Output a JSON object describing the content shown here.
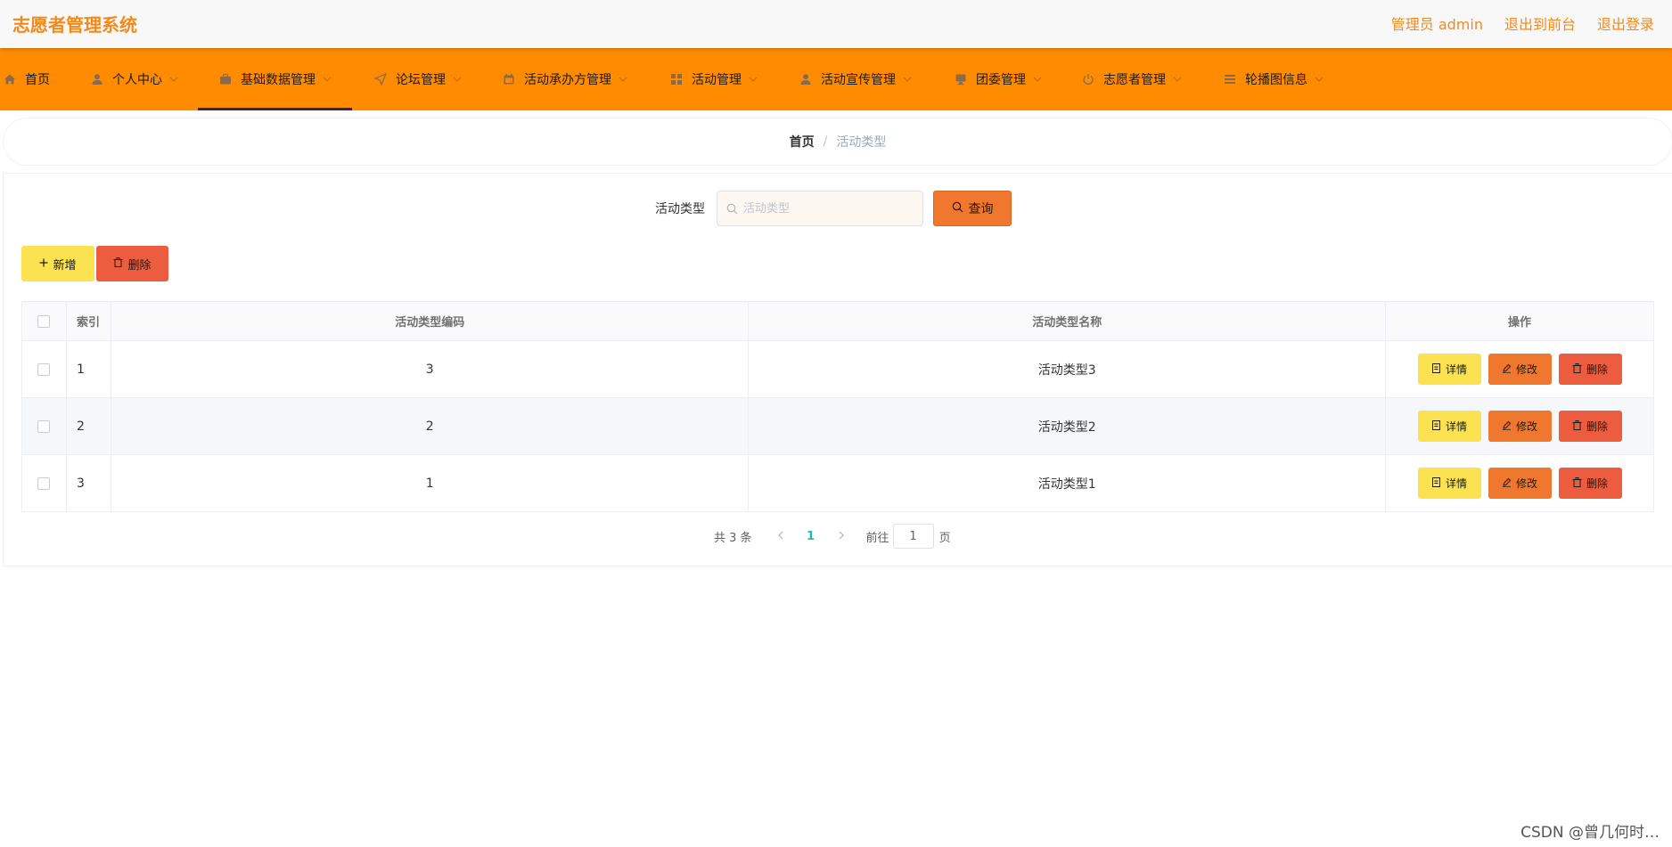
{
  "header": {
    "app_title": "志愿者管理系统",
    "links": [
      "管理员 admin",
      "退出到前台",
      "退出登录"
    ]
  },
  "nav": {
    "items": [
      {
        "label": "首页",
        "icon": "home-icon"
      },
      {
        "label": "个人中心",
        "icon": "user-icon"
      },
      {
        "label": "基础数据管理",
        "icon": "briefcase-icon"
      },
      {
        "label": "论坛管理",
        "icon": "send-icon"
      },
      {
        "label": "活动承办方管理",
        "icon": "calendar-icon"
      },
      {
        "label": "活动管理",
        "icon": "grid-icon"
      },
      {
        "label": "活动宣传管理",
        "icon": "user-icon"
      },
      {
        "label": "团委管理",
        "icon": "monitor-icon"
      },
      {
        "label": "志愿者管理",
        "icon": "power-icon"
      },
      {
        "label": "轮播图信息",
        "icon": "list-icon"
      }
    ],
    "active_index": 2
  },
  "breadcrumb": {
    "home": "首页",
    "separator": "/",
    "current": "活动类型"
  },
  "search": {
    "label": "活动类型",
    "placeholder": "活动类型",
    "value": "",
    "button_label": "查询"
  },
  "toolbar": {
    "add_label": "新增",
    "delete_label": "删除"
  },
  "table": {
    "columns": [
      "索引",
      "活动类型编码",
      "活动类型名称",
      "操作"
    ],
    "rows": [
      {
        "index": "1",
        "code": "3",
        "name": "活动类型3"
      },
      {
        "index": "2",
        "code": "2",
        "name": "活动类型2"
      },
      {
        "index": "3",
        "code": "1",
        "name": "活动类型1"
      }
    ],
    "actions": {
      "detail": "详情",
      "edit": "修改",
      "delete": "删除"
    }
  },
  "pagination": {
    "total_text": "共 3 条",
    "current_page": "1",
    "goto_prefix": "前往",
    "goto_value": "1",
    "goto_suffix": "页"
  },
  "watermark": "CSDN @曾几何时…",
  "colors": {
    "brand_orange": "#ff8c00",
    "title_orange": "#f28a1b",
    "button_yellow": "#fbe250",
    "button_orange": "#f0782e",
    "button_red": "#ec5c3e",
    "active_page": "#2fb5a0"
  }
}
